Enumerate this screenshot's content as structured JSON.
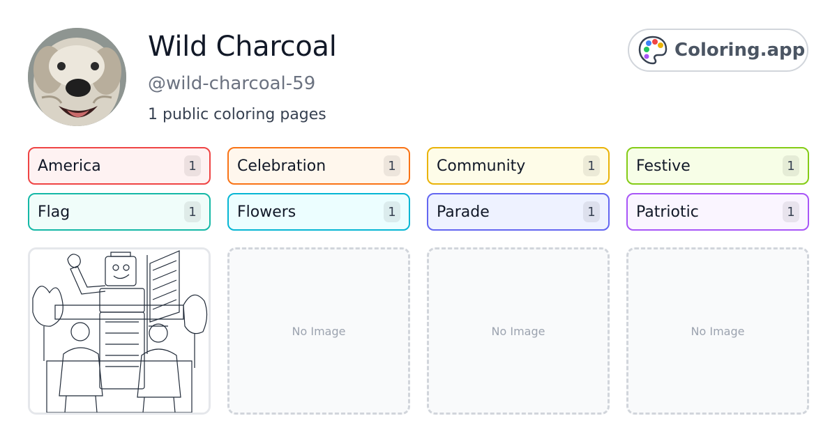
{
  "profile": {
    "name": "Wild Charcoal",
    "handle": "@wild-charcoal-59",
    "summary": "1 public coloring pages",
    "avatar_icon": "dog-photo"
  },
  "brand": {
    "label": "Coloring.app",
    "icon": "palette-icon"
  },
  "tags": [
    {
      "label": "America",
      "count": "1",
      "border": "#ef4444",
      "bg": "#fef2f2"
    },
    {
      "label": "Celebration",
      "count": "1",
      "border": "#f97316",
      "bg": "#fff7ed"
    },
    {
      "label": "Community",
      "count": "1",
      "border": "#eab308",
      "bg": "#fefce8"
    },
    {
      "label": "Festive",
      "count": "1",
      "border": "#84cc16",
      "bg": "#f7fee7"
    },
    {
      "label": "Flag",
      "count": "1",
      "border": "#14b8a6",
      "bg": "#f0fdfa"
    },
    {
      "label": "Flowers",
      "count": "1",
      "border": "#06b6d4",
      "bg": "#ecfeff"
    },
    {
      "label": "Parade",
      "count": "1",
      "border": "#6366f1",
      "bg": "#eef2ff"
    },
    {
      "label": "Patriotic",
      "count": "1",
      "border": "#a855f7",
      "bg": "#faf5ff"
    }
  ],
  "cards": [
    {
      "type": "image",
      "alt_icon": "coloring-page-thumbnail"
    },
    {
      "type": "empty",
      "label": "No Image"
    },
    {
      "type": "empty",
      "label": "No Image"
    },
    {
      "type": "empty",
      "label": "No Image"
    }
  ]
}
